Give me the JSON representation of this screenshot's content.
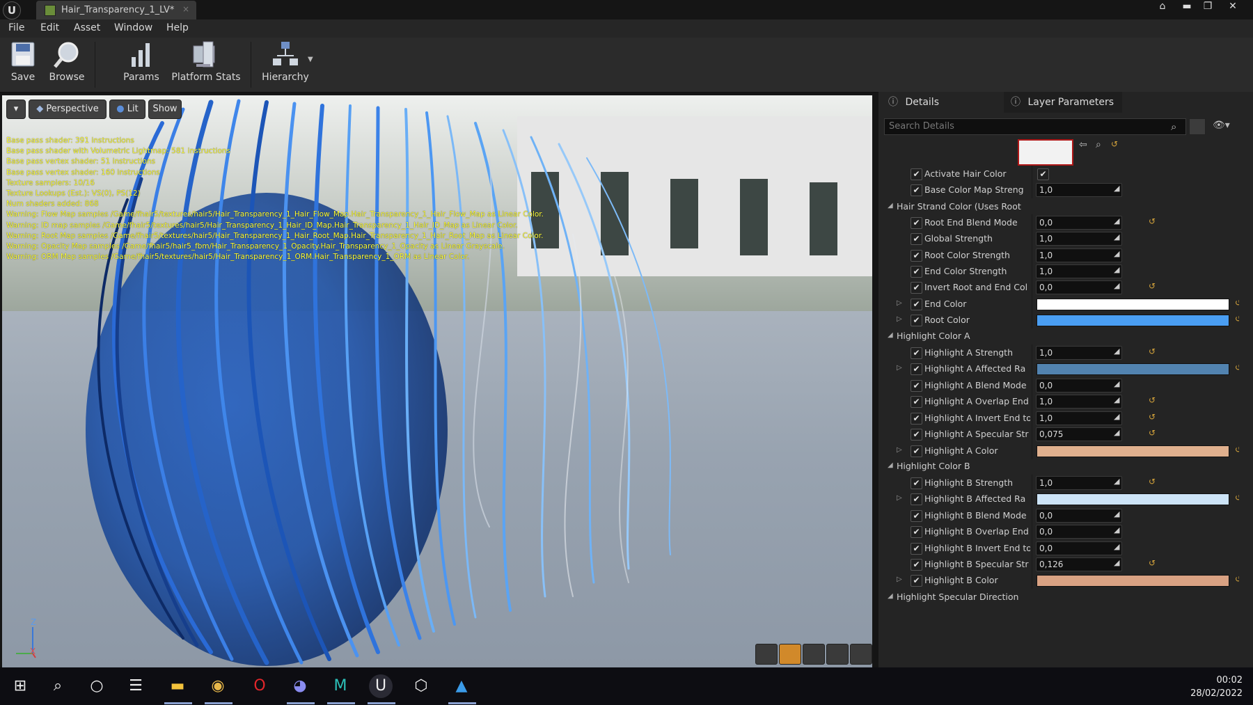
{
  "window": {
    "tab_title": "Hair_Transparency_1_LV*",
    "tab_close": "×",
    "logo_text": "U"
  },
  "menu": [
    "File",
    "Edit",
    "Asset",
    "Window",
    "Help"
  ],
  "toolbar": {
    "save": "Save",
    "browse": "Browse",
    "params": "Params",
    "platform_stats": "Platform Stats",
    "hierarchy": "Hierarchy"
  },
  "viewport": {
    "perspective": "Perspective",
    "lit": "Lit",
    "show": "Show",
    "axis_z": "Z",
    "axis_x": "X",
    "stats": [
      "Base pass shader: 391 instructions",
      "Base pass shader with Volumetric Lightmap: 581 instructions",
      "Base pass vertex shader: 51 instructions",
      "Base pass vertex shader: 160 instructions",
      "Texture samplers: 10/16",
      "Texture Lookups (Est.): VS(0), PS(12)",
      "Num shaders added: 868",
      "Warning: Flow Map samples /Game/fhair5/textures/hair5/Hair_Transparency_1_Hair_Flow_Map.Hair_Transparency_1_Hair_Flow_Map as Linear Color.",
      "Warning: ID map samples /Game/fhair5/textures/hair5/Hair_Transparency_1_Hair_ID_Map.Hair_Transparency_1_Hair_ID_Map as Linear Color.",
      "Warning: Root Map samples /Game/fhair5/textures/hair5/Hair_Transparency_1_Hair_Root_Map.Hair_Transparency_1_Hair_Root_Map as Linear Color.",
      "Warning: Opacity Map samples /Game/fhair5/hair5_fbm/Hair_Transparency_1_Opacity.Hair_Transparency_1_Opacity as Linear Grayscale.",
      "Warning: ORM Map samples /Game/fhair5/textures/hair5/Hair_Transparency_1_ORM.Hair_Transparency_1_ORM as Linear Color."
    ]
  },
  "details": {
    "tab_details": "Details",
    "tab_layer": "Layer Parameters",
    "search_placeholder": "Search Details",
    "rows": {
      "activate_hair_color": {
        "label": "Activate Hair Color"
      },
      "base_color_map_strength": {
        "label": "Base Color Map Streng",
        "value": "1,0"
      },
      "cat_hair_strand": {
        "label": "Hair Strand Color (Uses Root"
      },
      "root_end_blend": {
        "label": "Root End Blend Mode",
        "value": "0,0"
      },
      "global_strength": {
        "label": "Global Strength",
        "value": "1,0"
      },
      "root_color_strength": {
        "label": "Root Color Strength",
        "value": "1,0"
      },
      "end_color_strength": {
        "label": "End Color Strength",
        "value": "1,0"
      },
      "invert_root_end": {
        "label": "Invert Root and End Col",
        "value": "0,0"
      },
      "end_color": {
        "label": "End Color",
        "color": "#ffffff"
      },
      "root_color": {
        "label": "Root Color",
        "color": "#4a9ef2"
      },
      "cat_highlight_a": {
        "label": "Highlight Color A"
      },
      "ha_strength": {
        "label": "Highlight A Strength",
        "value": "1,0"
      },
      "ha_affected": {
        "label": "Highlight A Affected Ra",
        "color": "#5283b0"
      },
      "ha_blend": {
        "label": "Highlight A Blend Mode",
        "value": "0,0"
      },
      "ha_overlap": {
        "label": "Highlight A Overlap End",
        "value": "1,0"
      },
      "ha_invert": {
        "label": "Highlight A Invert End to",
        "value": "1,0"
      },
      "ha_specular": {
        "label": "Highlight A Specular Str",
        "value": "0,075"
      },
      "ha_color": {
        "label": "Highlight A Color",
        "color": "#e0b08e"
      },
      "cat_highlight_b": {
        "label": "Highlight Color B"
      },
      "hb_strength": {
        "label": "Highlight B Strength",
        "value": "1,0"
      },
      "hb_affected": {
        "label": "Highlight B Affected Ra",
        "color": "#cde4f7"
      },
      "hb_blend": {
        "label": "Highlight B Blend Mode",
        "value": "0,0"
      },
      "hb_overlap": {
        "label": "Highlight B Overlap End",
        "value": "0,0"
      },
      "hb_invert": {
        "label": "Highlight B Invert End to",
        "value": "0,0"
      },
      "hb_specular": {
        "label": "Highlight B Specular Str",
        "value": "0,126"
      },
      "hb_color": {
        "label": "Highlight B Color",
        "color": "#d9a283"
      },
      "cat_specular_dir": {
        "label": "Highlight Specular Direction"
      }
    }
  },
  "taskbar": {
    "time": "00:02",
    "date": "28/02/2022"
  },
  "colors": {
    "accent_orange": "#d1892a",
    "warning_text": "#ffff3a",
    "reset_arrow": "#d4a33b"
  }
}
